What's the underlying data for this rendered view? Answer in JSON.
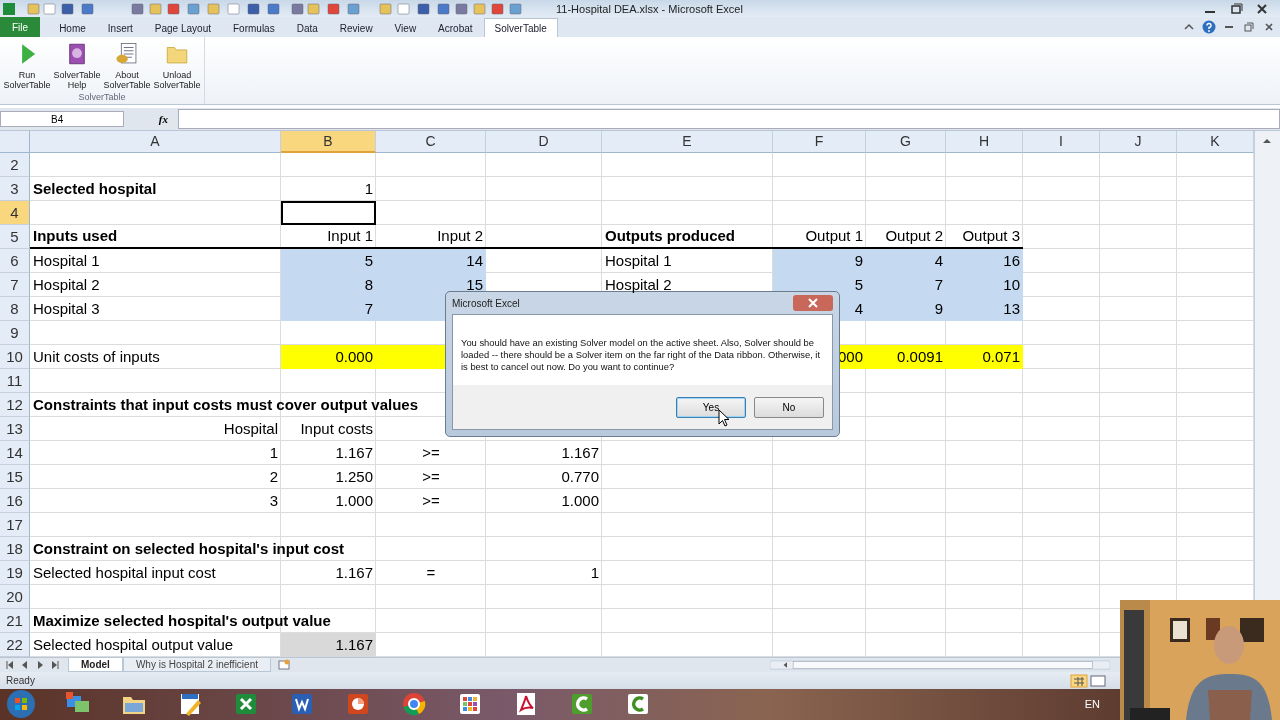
{
  "window": {
    "title": "11-Hospital DEA.xlsx - Microsoft Excel"
  },
  "ribbon": {
    "file_tab": "File",
    "tabs": [
      {
        "label": "Home",
        "selected": false
      },
      {
        "label": "Insert",
        "selected": false
      },
      {
        "label": "Page Layout",
        "selected": false
      },
      {
        "label": "Formulas",
        "selected": false
      },
      {
        "label": "Data",
        "selected": false
      },
      {
        "label": "Review",
        "selected": false
      },
      {
        "label": "View",
        "selected": false
      },
      {
        "label": "Acrobat",
        "selected": false
      },
      {
        "label": "SolverTable",
        "selected": true
      }
    ],
    "buttons": [
      {
        "label": "Run\nSolverTable",
        "kind": "run"
      },
      {
        "label": "SolverTable\nHelp",
        "kind": "help"
      },
      {
        "label": "About\nSolverTable",
        "kind": "about"
      },
      {
        "label": "Unload\nSolverTable",
        "kind": "unload"
      }
    ],
    "group_label": "SolverTable"
  },
  "formula_bar": {
    "name_box": "B4",
    "fx": "fx"
  },
  "columns": [
    {
      "label": "A",
      "selected": false
    },
    {
      "label": "B",
      "selected": true
    },
    {
      "label": "C",
      "selected": false
    },
    {
      "label": "D",
      "selected": false
    },
    {
      "label": "E",
      "selected": false
    },
    {
      "label": "F",
      "selected": false
    },
    {
      "label": "G",
      "selected": false
    },
    {
      "label": "H",
      "selected": false
    },
    {
      "label": "I",
      "selected": false
    },
    {
      "label": "J",
      "selected": false
    },
    {
      "label": "K",
      "selected": false
    }
  ],
  "rows": [
    {
      "num": "2",
      "selected": false
    },
    {
      "num": "3",
      "selected": false,
      "cells": [
        {
          "text": "Selected hospital",
          "kind": "label",
          "bold": true
        },
        {
          "text": "1",
          "kind": "value"
        }
      ]
    },
    {
      "num": "4",
      "selected": true
    },
    {
      "num": "5",
      "selected": false,
      "cells": [
        {
          "text": "Inputs used",
          "kind": "label",
          "bold": true,
          "rule": true
        },
        {
          "text": "Input 1",
          "kind": "value",
          "rule": true
        },
        {
          "text": "Input 2",
          "kind": "value",
          "rule": true
        },
        {
          "rule": true
        },
        {
          "text": "Outputs produced",
          "kind": "label",
          "bold": true,
          "rule": true
        },
        {
          "text": "Output 1",
          "kind": "value",
          "rule": true
        },
        {
          "text": "Output 2",
          "kind": "value",
          "rule": true
        },
        {
          "text": "Output 3",
          "kind": "value",
          "rule": true
        }
      ]
    },
    {
      "num": "6",
      "selected": false,
      "cells": [
        {
          "text": "Hospital 1",
          "kind": "label"
        },
        {
          "text": "5",
          "kind": "value",
          "color": "#c5d9f1"
        },
        {
          "text": "14",
          "kind": "value",
          "color": "#c5d9f1"
        },
        {},
        {
          "text": "Hospital 1",
          "kind": "label"
        },
        {
          "text": "9",
          "kind": "value",
          "color": "#c5d9f1"
        },
        {
          "text": "4",
          "kind": "value",
          "color": "#c5d9f1"
        },
        {
          "text": "16",
          "kind": "value",
          "color": "#c5d9f1"
        }
      ]
    },
    {
      "num": "7",
      "selected": false,
      "cells": [
        {
          "text": "Hospital 2",
          "kind": "label"
        },
        {
          "text": "8",
          "kind": "value",
          "color": "#c5d9f1"
        },
        {
          "text": "15",
          "kind": "value",
          "color": "#c5d9f1"
        },
        {},
        {
          "text": "Hospital 2",
          "kind": "label"
        },
        {
          "text": "5",
          "kind": "value",
          "color": "#c5d9f1"
        },
        {
          "text": "7",
          "kind": "value",
          "color": "#c5d9f1"
        },
        {
          "text": "10",
          "kind": "value",
          "color": "#c5d9f1"
        }
      ]
    },
    {
      "num": "8",
      "selected": false,
      "cells": [
        {
          "text": "Hospital 3",
          "kind": "label"
        },
        {
          "text": "7",
          "kind": "value",
          "color": "#c5d9f1"
        },
        {
          "color": "#c5d9f1"
        },
        {},
        {},
        {
          "text": "4",
          "kind": "value",
          "color": "#c5d9f1"
        },
        {
          "text": "9",
          "kind": "value",
          "color": "#c5d9f1"
        },
        {
          "text": "13",
          "kind": "value",
          "color": "#c5d9f1"
        }
      ]
    },
    {
      "num": "9",
      "selected": false
    },
    {
      "num": "10",
      "selected": false,
      "cells": [
        {
          "text": "Unit costs of inputs",
          "kind": "label"
        },
        {
          "text": "0.000",
          "kind": "value",
          "color": "#ffff00"
        },
        {
          "color": "#ffff00"
        },
        {},
        {},
        {
          "text": "000",
          "kind": "value",
          "color": "#ffff00"
        },
        {
          "text": "0.0091",
          "kind": "value",
          "color": "#ffff00"
        },
        {
          "text": "0.071",
          "kind": "value",
          "color": "#ffff00"
        }
      ]
    },
    {
      "num": "11",
      "selected": false
    },
    {
      "num": "12",
      "selected": false,
      "cells": [
        {
          "text": "Constraints that input costs must cover output values",
          "kind": "label",
          "bold": true
        }
      ]
    },
    {
      "num": "13",
      "selected": false,
      "cells": [
        {
          "text": "Hospital",
          "kind": "value"
        },
        {
          "text": "Input costs",
          "kind": "value"
        }
      ]
    },
    {
      "num": "14",
      "selected": false,
      "cells": [
        {
          "text": "1",
          "kind": "value"
        },
        {
          "text": "1.167",
          "kind": "value"
        },
        {
          "text": ">=",
          "kind": "operator"
        },
        {
          "text": "1.167",
          "kind": "value"
        }
      ]
    },
    {
      "num": "15",
      "selected": false,
      "cells": [
        {
          "text": "2",
          "kind": "value"
        },
        {
          "text": "1.250",
          "kind": "value"
        },
        {
          "text": ">=",
          "kind": "operator"
        },
        {
          "text": "0.770",
          "kind": "value"
        }
      ]
    },
    {
      "num": "16",
      "selected": false,
      "cells": [
        {
          "text": "3",
          "kind": "value"
        },
        {
          "text": "1.000",
          "kind": "value"
        },
        {
          "text": ">=",
          "kind": "operator"
        },
        {
          "text": "1.000",
          "kind": "value"
        }
      ]
    },
    {
      "num": "17",
      "selected": false
    },
    {
      "num": "18",
      "selected": false,
      "cells": [
        {
          "text": "Constraint on selected hospital's input cost",
          "kind": "label",
          "bold": true
        }
      ]
    },
    {
      "num": "19",
      "selected": false,
      "cells": [
        {
          "text": "Selected hospital input cost",
          "kind": "label"
        },
        {
          "text": "1.167",
          "kind": "value"
        },
        {
          "text": "=",
          "kind": "operator"
        },
        {
          "text": "1",
          "kind": "value"
        }
      ]
    },
    {
      "num": "20",
      "selected": false
    },
    {
      "num": "21",
      "selected": false,
      "cells": [
        {
          "text": "Maximize selected hospital's output value",
          "kind": "label",
          "bold": true
        }
      ]
    },
    {
      "num": "22",
      "selected": false,
      "cells": [
        {
          "text": "Selected hospital output value",
          "kind": "label"
        },
        {
          "text": "1.167",
          "kind": "value",
          "color": "#d9d9d9"
        }
      ]
    }
  ],
  "sheet_tabs": [
    {
      "label": "Model",
      "selected": true
    },
    {
      "label": "Why is Hospital 2 inefficient",
      "selected": false
    }
  ],
  "status_bar": {
    "text": "Ready"
  },
  "taskbar": {
    "apps": [
      {
        "kind": "remote"
      },
      {
        "kind": "folder"
      },
      {
        "kind": "editor"
      },
      {
        "kind": "excel"
      },
      {
        "kind": "word"
      },
      {
        "kind": "slides"
      },
      {
        "kind": "browser"
      },
      {
        "kind": "apps"
      },
      {
        "kind": "pdf"
      },
      {
        "kind": "recorder"
      },
      {
        "kind": "recorder2"
      }
    ],
    "language": "EN"
  },
  "dialog": {
    "title": "Microsoft Excel",
    "message": "You should have an existing Solver model on the active sheet. Also, Solver should be loaded -- there should be a Solver item on the far right of the Data ribbon. Otherwise, it is best to cancel out now. Do you want to continue?",
    "buttons": [
      {
        "label": "Yes",
        "selected": true
      },
      {
        "label": "No",
        "selected": false
      }
    ]
  }
}
